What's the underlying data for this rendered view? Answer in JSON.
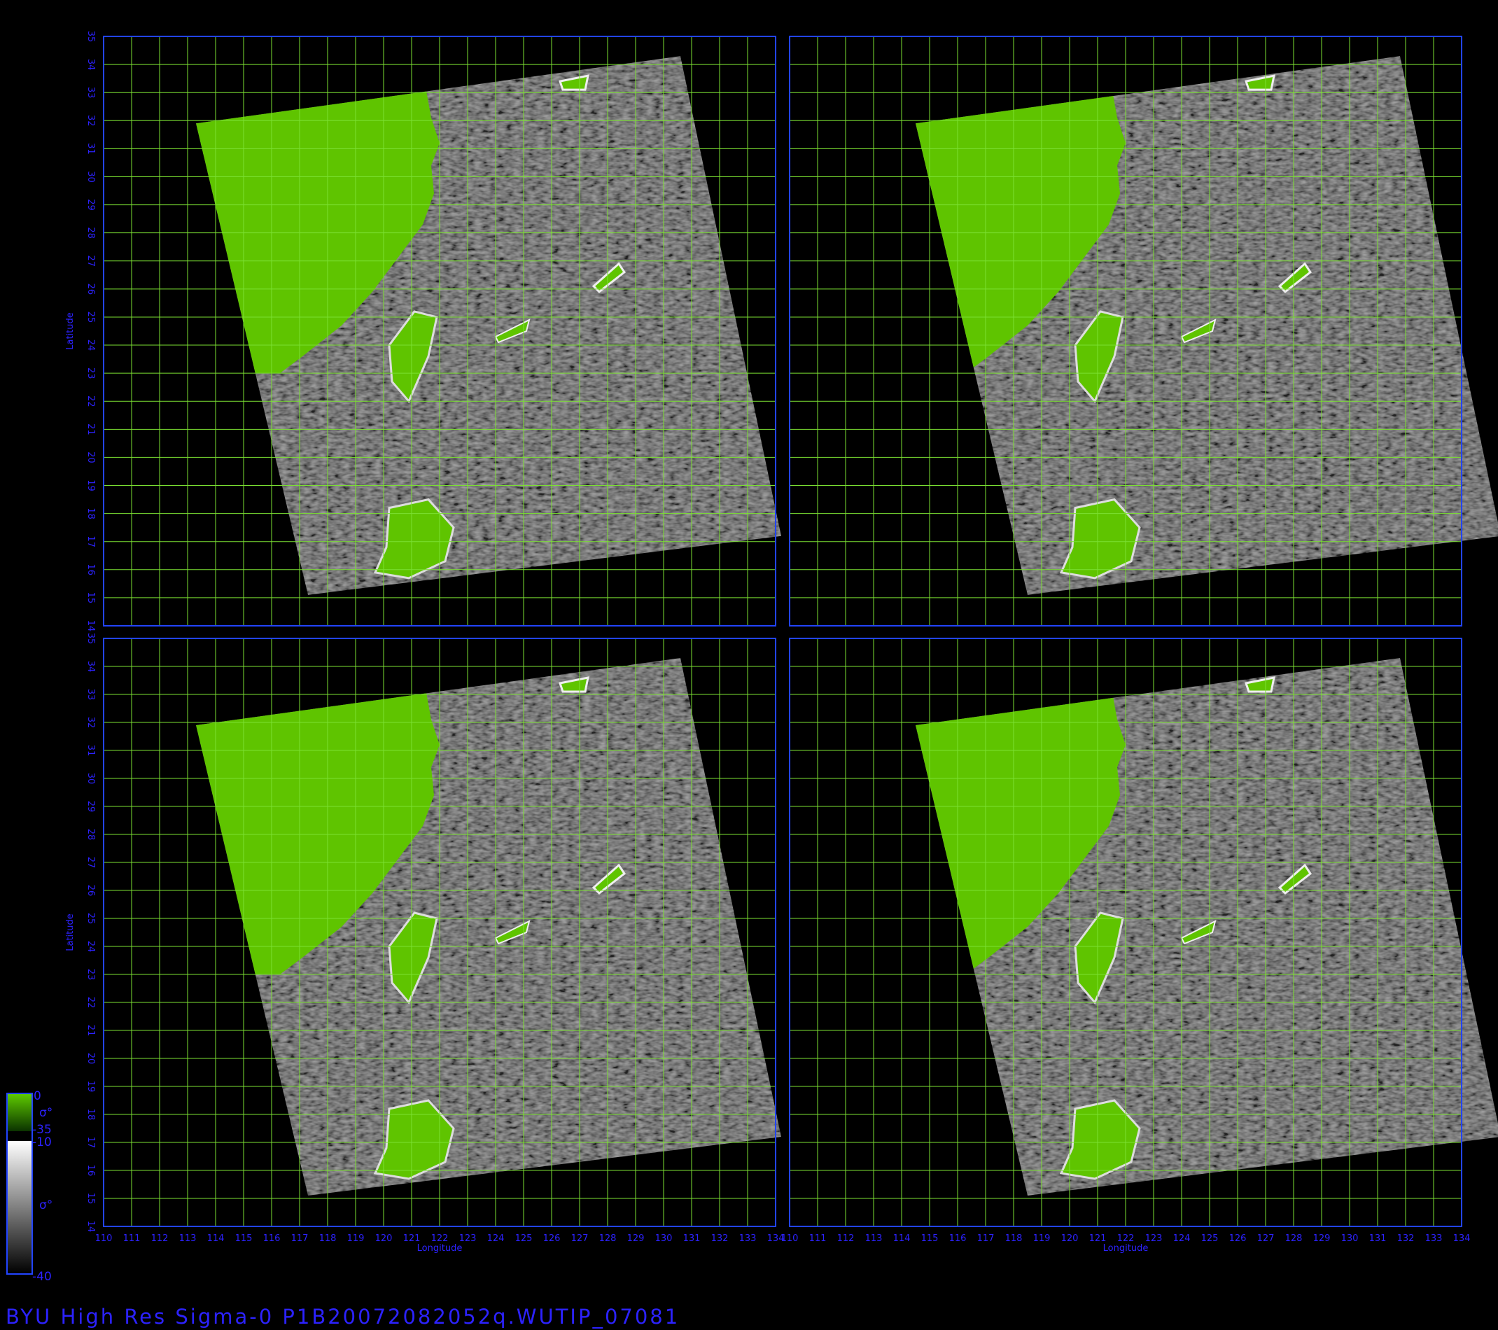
{
  "product_title": "BYU High Res Sigma-0 P1B20072082052q.WUTIP_07081",
  "map_axes": {
    "xlabel": "Longitude",
    "ylabel": "Latitude",
    "lon_range": [
      110,
      134
    ],
    "lat_range": [
      14,
      35
    ],
    "lon_ticks": [
      "110",
      "111",
      "112",
      "113",
      "114",
      "115",
      "116",
      "117",
      "118",
      "119",
      "120",
      "121",
      "122",
      "123",
      "124",
      "125",
      "126",
      "127",
      "128",
      "129",
      "130",
      "131",
      "132",
      "133",
      "134"
    ],
    "lat_ticks": [
      "14",
      "15",
      "16",
      "17",
      "18",
      "19",
      "20",
      "21",
      "22",
      "23",
      "24",
      "25",
      "26",
      "27",
      "28",
      "29",
      "30",
      "31",
      "32",
      "33",
      "34",
      "35"
    ],
    "grid": true,
    "grid_color": "#7be032",
    "frame_color": "#2244ff",
    "label_color": "#2c22ff"
  },
  "panels": [
    {
      "position": "top-left",
      "swath_lon_offset": 0
    },
    {
      "position": "top-right",
      "swath_lon_offset": 0
    },
    {
      "position": "bottom-left",
      "swath_lon_offset": 0
    },
    {
      "position": "bottom-right",
      "swath_lon_offset": 0
    }
  ],
  "colorbar": {
    "land_scale": {
      "max": "0",
      "min": "-35",
      "symbol": "σ°",
      "color": "#5fcc00"
    },
    "ocean_scale": {
      "max": "-10",
      "min": "-40",
      "symbol": "σ°"
    }
  },
  "colors": {
    "land": "#5fc400",
    "ocean": "#4a4a4a",
    "background": "#000000"
  }
}
